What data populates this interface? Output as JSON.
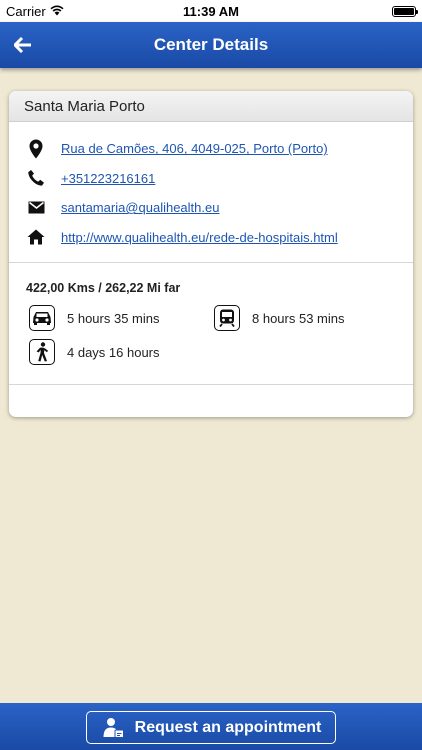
{
  "status_bar": {
    "carrier": "Carrier",
    "time": "11:39 AM"
  },
  "nav": {
    "title": "Center Details",
    "back_icon": "arrow-left-icon"
  },
  "center": {
    "name": "Santa Maria Porto",
    "address": "Rua de Camões, 406, 4049-025, Porto (Porto)",
    "phone": "+351223216161",
    "email": "santamaria@qualihealth.eu",
    "website": "http://www.qualihealth.eu/rede-de-hospitais.html"
  },
  "travel": {
    "distance": "422,00 Kms / 262,22 Mi far",
    "car": "5 hours 35 mins",
    "train": "8 hours 53 mins",
    "walk": "4 days 16 hours"
  },
  "footer": {
    "appointment_label": "Request an appointment"
  },
  "colors": {
    "brand_blue": "#1f52b3",
    "link": "#1e55b3",
    "background": "#efe9d3"
  }
}
